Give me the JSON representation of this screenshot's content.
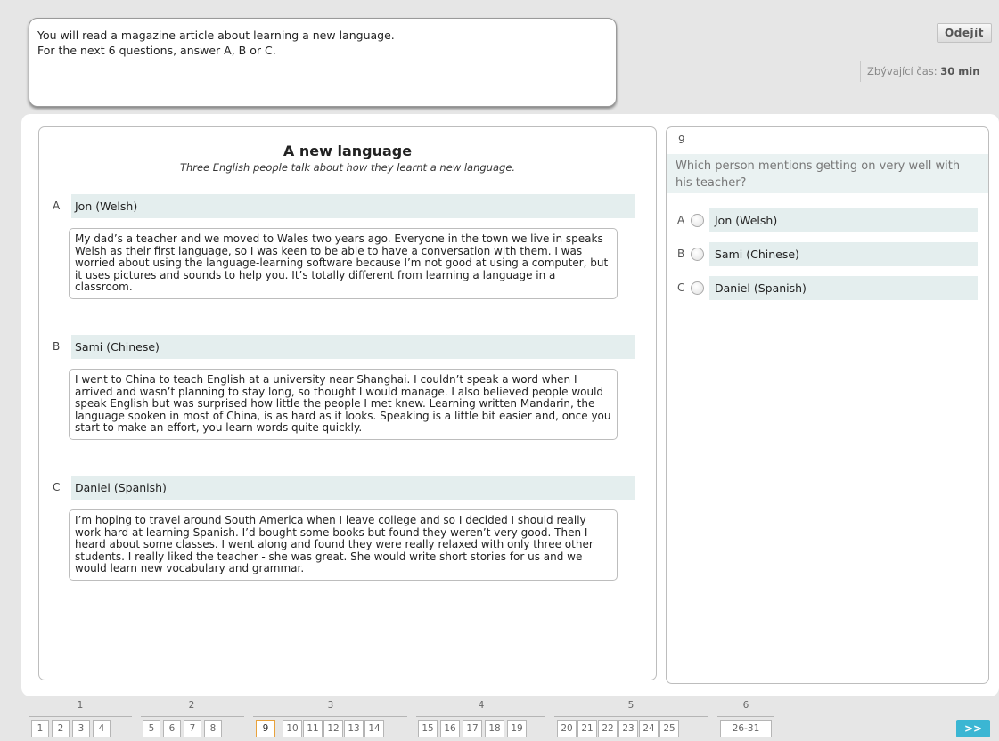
{
  "instructions": {
    "line1": "You will read a magazine article about learning a new language.",
    "line2": "For the next 6 questions, answer A, B or C."
  },
  "header": {
    "exit_label": "Odejít",
    "timer_label": "Zbývající čas:",
    "timer_value": "30 min"
  },
  "article": {
    "title": "A new language",
    "subtitle": "Three English people talk about how they learnt a new language.",
    "people": [
      {
        "letter": "A",
        "name": "Jon (Welsh)",
        "text": "My dad’s a teacher and we moved to Wales two years ago. Everyone in the town we live in speaks Welsh as their first language, so I was keen to be able to have a conversation with them. I was worried about using the language-learning software because I’m not good at using a computer, but it uses pictures and sounds to help you. It’s totally different from learning a language in a classroom."
      },
      {
        "letter": "B",
        "name": "Sami (Chinese)",
        "text": "I went to China to teach English at a university near Shanghai. I couldn’t speak a word when I arrived and wasn’t planning to stay long, so thought I would manage. I also believed people would speak English but was surprised how little the people I met knew. Learning written Mandarin, the language spoken in most of China, is as hard as it looks. Speaking is a little bit easier and, once you start to make an effort, you learn words quite quickly."
      },
      {
        "letter": "C",
        "name": "Daniel (Spanish)",
        "text": "I’m hoping to travel around South America when I leave college and so I decided I should really work hard at learning Spanish. I’d bought some books but found they weren’t very good. Then I heard about some classes. I went along and found they were really relaxed with only three other students. I really liked the teacher - she was great. She would write short stories for us and we would learn new vocabulary and grammar."
      }
    ]
  },
  "question": {
    "number": "9",
    "text": "Which person mentions getting on very well with his teacher?",
    "options": [
      {
        "letter": "A",
        "label": "Jon (Welsh)"
      },
      {
        "letter": "B",
        "label": "Sami (Chinese)"
      },
      {
        "letter": "C",
        "label": "Daniel (Spanish)"
      }
    ]
  },
  "navigation": {
    "groups": [
      "1",
      "2",
      "3",
      "4",
      "5",
      "6"
    ],
    "buttons": [
      "1",
      "2",
      "3",
      "4",
      "5",
      "6",
      "7",
      "8",
      "9",
      "10",
      "11",
      "12",
      "13",
      "14",
      "15",
      "16",
      "17",
      "18",
      "19",
      "20",
      "21",
      "22",
      "23",
      "24",
      "25",
      "26-31"
    ],
    "current": "9",
    "next_label": ">>"
  }
}
